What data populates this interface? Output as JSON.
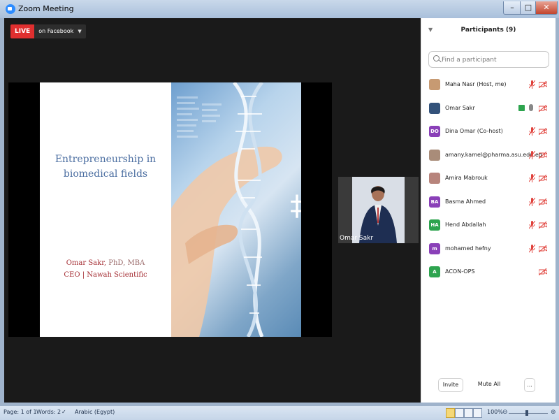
{
  "window": {
    "title": "Zoom Meeting",
    "minimize": "–",
    "maximize": "□",
    "close": "✕"
  },
  "live": {
    "badge": "LIVE",
    "target": "on Facebook"
  },
  "slide": {
    "title_line1": "Entrepreneurship in",
    "title_line2": "biomedical fields",
    "author_name": "Omar Sakr,",
    "author_degrees": "PhD, MBA",
    "author_role": "CEO | Nawah Scientific"
  },
  "video_tile": {
    "name": "Omar Sakr"
  },
  "participants": {
    "header": "Participants (9)",
    "search_placeholder": "Find a participant",
    "items": [
      {
        "name": "Maha Nasr (Host, me)",
        "avatar": "",
        "avatar_color": "#c79a72",
        "mic": "off",
        "video": "off"
      },
      {
        "name": "Omar Sakr",
        "avatar": "",
        "avatar_color": "#33527a",
        "mic": "on",
        "video": "off",
        "sharing": true
      },
      {
        "name": "Dina Omar (Co-host)",
        "avatar": "DO",
        "avatar_color": "#8a40b8",
        "mic": "off",
        "video": "off"
      },
      {
        "name": "amany.kamel@pharma.asu.edu.eg",
        "avatar": "",
        "avatar_color": "#a98c79",
        "mic": "off",
        "video": "off"
      },
      {
        "name": "Amira Mabrouk",
        "avatar": "",
        "avatar_color": "#b7847c",
        "mic": "off",
        "video": "off"
      },
      {
        "name": "Basma Ahmed",
        "avatar": "BA",
        "avatar_color": "#8a40b8",
        "mic": "off",
        "video": "off"
      },
      {
        "name": "Hend Abdallah",
        "avatar": "HA",
        "avatar_color": "#2ea44f",
        "mic": "off",
        "video": "off"
      },
      {
        "name": "mohamed hefny",
        "avatar": "m",
        "avatar_color": "#8a40b8",
        "mic": "off",
        "video": "off"
      },
      {
        "name": "ACON-OPS",
        "avatar": "A",
        "avatar_color": "#2ea44f",
        "mic": "none",
        "video": "off"
      }
    ],
    "invite_label": "Invite",
    "mute_all_label": "Mute All",
    "more_label": "..."
  },
  "statusbar": {
    "page": "Page: 1 of 1",
    "words": "Words: 2",
    "language": "Arabic (Egypt)",
    "zoom": "100%",
    "zoom_level_percent": 100
  }
}
